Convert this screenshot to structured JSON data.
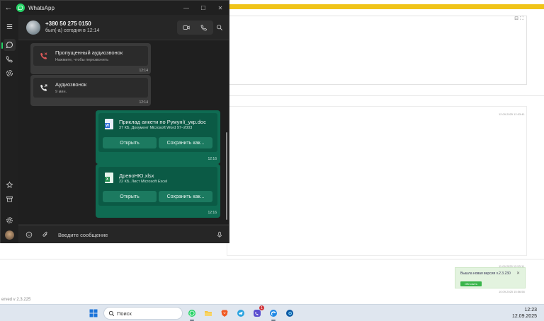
{
  "window": {
    "title": "WhatsApp",
    "controls": {
      "minimize": "—",
      "maximize": "☐",
      "close": "✕"
    }
  },
  "chat_header": {
    "contact": "+380 50 275 0150",
    "status": "был(-а) сегодня в 12:14"
  },
  "messages": {
    "calls": [
      {
        "title": "Пропущенный аудиозвонок",
        "subtitle": "Нажмите, чтобы перезвонить",
        "time": "12:14",
        "icon": "missed-call-icon"
      },
      {
        "title": "Аудиозвонок",
        "subtitle": "9 мин.",
        "time": "12:14",
        "icon": "call-icon"
      }
    ],
    "documents": [
      {
        "name": "Приклад анкети по Румунії_укр.doc",
        "meta": "37 КБ, Документ Microsoft Word 97–2003",
        "open_label": "Открыть",
        "save_label": "Сохранить как...",
        "time": "12:16",
        "icon": "word-file-icon",
        "icon_letter": "W",
        "color": "#2b6cd4"
      },
      {
        "name": "ДревоНЮ.xlsx",
        "meta": "22 КБ, Лист Microsoft Excel",
        "open_label": "Открыть",
        "save_label": "Сохранить как...",
        "time": "12:16",
        "icon": "excel-file-icon",
        "icon_letter": "X",
        "color": "#1f8a4c"
      }
    ]
  },
  "composer": {
    "placeholder": "Введите сообщение"
  },
  "background": {
    "timestamps": [
      "12.09.2025 12:03:41",
      "11.09.2025 12:53:11",
      "10.09.2025 15:56:58"
    ],
    "version_text": "erved v 2.3.225",
    "toast": {
      "text": "Вышла новая версия v.2.3.230",
      "close": "✕",
      "button": "Обновить"
    },
    "panel_icons": "⊟ ⛶"
  },
  "taskbar": {
    "search_placeholder": "Поиск",
    "apps": [
      "whatsapp-icon",
      "file-explorer-icon",
      "brave-icon",
      "telegram-icon",
      "viber-icon",
      "browser-icon",
      "edge-icon"
    ],
    "badge": "1",
    "time": "12:23",
    "date": "12.09.2025"
  },
  "colors": {
    "accent": "#25d366",
    "bubble_out": "#0f6b52",
    "missed": "#e05a5a"
  }
}
